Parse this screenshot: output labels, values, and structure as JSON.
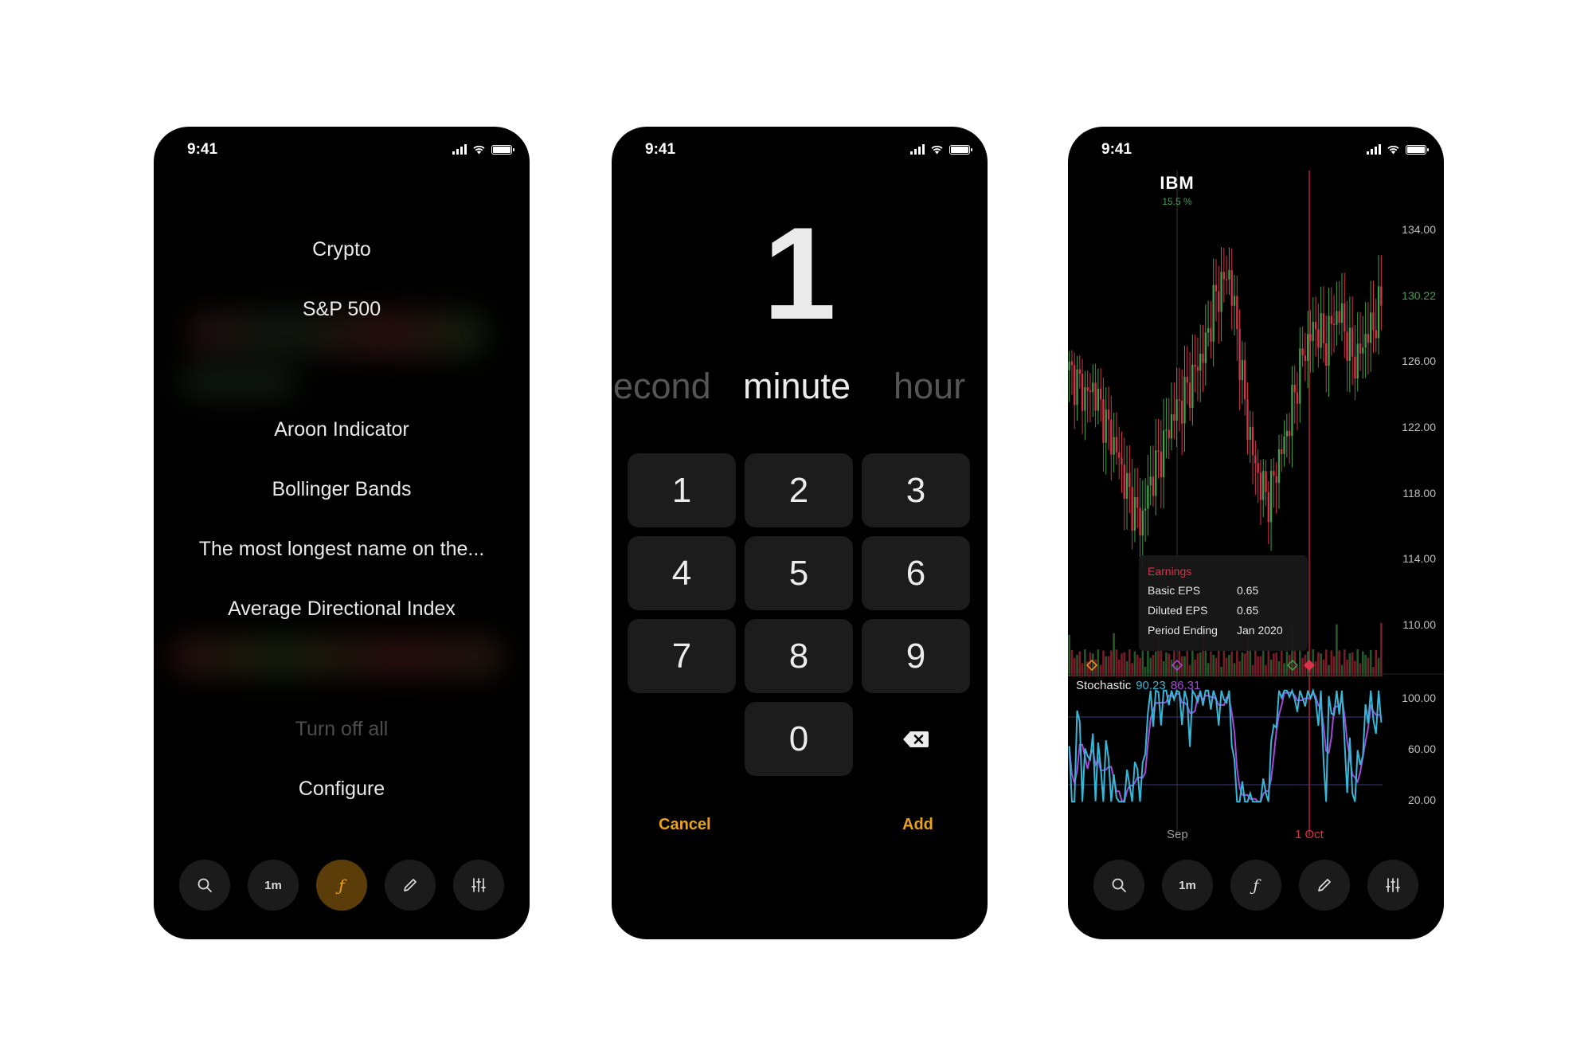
{
  "colors": {
    "accent": "#e8a317",
    "up": "#3fa34d",
    "down": "#d9334a",
    "stoch_k": "#37b7d7",
    "stoch_d": "#a64ad9"
  },
  "status": {
    "time": "9:41"
  },
  "nav": {
    "search_icon": "search-icon",
    "interval_label": "1m",
    "indicator_label": "ƒ",
    "draw_icon": "pencil-icon",
    "settings_icon": "sliders-icon"
  },
  "menu": {
    "items": [
      "Crypto",
      "S&P 500",
      "Aroon Indicator",
      "Bollinger Bands",
      "The most longest name on the...",
      "Average Directional Index"
    ],
    "turn_off": "Turn off all",
    "configure": "Configure"
  },
  "picker": {
    "value": "1",
    "units": [
      "econd",
      "minute",
      "hour"
    ],
    "selected_unit": "minute",
    "keys": [
      "1",
      "2",
      "3",
      "4",
      "5",
      "6",
      "7",
      "8",
      "9",
      "",
      "0",
      "delete"
    ],
    "cancel": "Cancel",
    "add": "Add"
  },
  "chart": {
    "ticker": "IBM",
    "change": "15.5 %",
    "price_axis": [
      "134.00",
      "130.22",
      "126.00",
      "122.00",
      "118.00",
      "114.00",
      "110.00"
    ],
    "current_price": "130.22",
    "earnings": {
      "title": "Earnings",
      "rows": [
        {
          "label": "Basic EPS",
          "value": "0.65"
        },
        {
          "label": "Diluted EPS",
          "value": "0.65"
        },
        {
          "label": "Period Ending",
          "value": "Jan 2020"
        }
      ]
    },
    "stochastic": {
      "label": "Stochastic",
      "k": "90.23",
      "d": "86.31",
      "axis": [
        "100.00",
        "60.00",
        "20.00"
      ]
    },
    "x_labels": [
      "Sep",
      "1 Oct"
    ]
  },
  "chart_data": {
    "type": "line",
    "title": "IBM",
    "x_ticks": [
      "Sep",
      "1 Oct"
    ],
    "ylim": [
      108,
      136
    ],
    "y_ticks": [
      110,
      114,
      118,
      122,
      126,
      130.22,
      134
    ],
    "series": [
      {
        "values": [
          124.8,
          124.2,
          123.5,
          123.9,
          122.6,
          121.4,
          120.2,
          118.5,
          117.1,
          116.2,
          118.4,
          119.6,
          121.0,
          122.4,
          123.1,
          124.0,
          125.2,
          126.2,
          128.6,
          129.8,
          130.4,
          127.0,
          122.8,
          120.0,
          118.3,
          117.6,
          119.6,
          121.0,
          123.2,
          125.4,
          126.8,
          127.4,
          126.2,
          127.9,
          128.1,
          126.0,
          125.4,
          126.8,
          127.4,
          128.7
        ]
      }
    ]
  }
}
